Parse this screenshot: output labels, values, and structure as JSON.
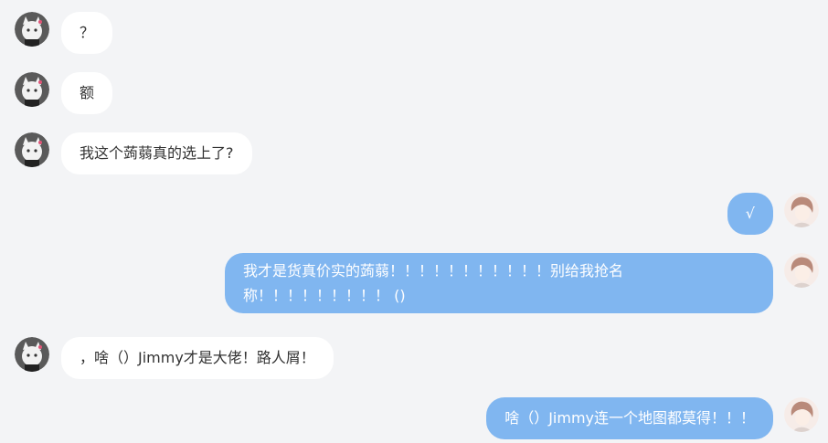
{
  "messages": [
    {
      "side": "in",
      "text": "？"
    },
    {
      "side": "in",
      "text": "额"
    },
    {
      "side": "in",
      "text": "我这个蒟蒻真的选上了?"
    },
    {
      "side": "out",
      "text": "√"
    },
    {
      "side": "out",
      "text": "我才是货真价实的蒟蒻！！！！！！！！！！！别给我抢名称！！！！！！！！！ ()"
    },
    {
      "side": "in",
      "text": "，啥（）Jimmy才是大佬！路人屑！"
    },
    {
      "side": "out",
      "text": "啥（）Jimmy连一个地图都莫得！！！"
    }
  ],
  "colors": {
    "background": "#f3f4f6",
    "incoming_bubble": "#ffffff",
    "outgoing_bubble": "#80b6f0"
  }
}
